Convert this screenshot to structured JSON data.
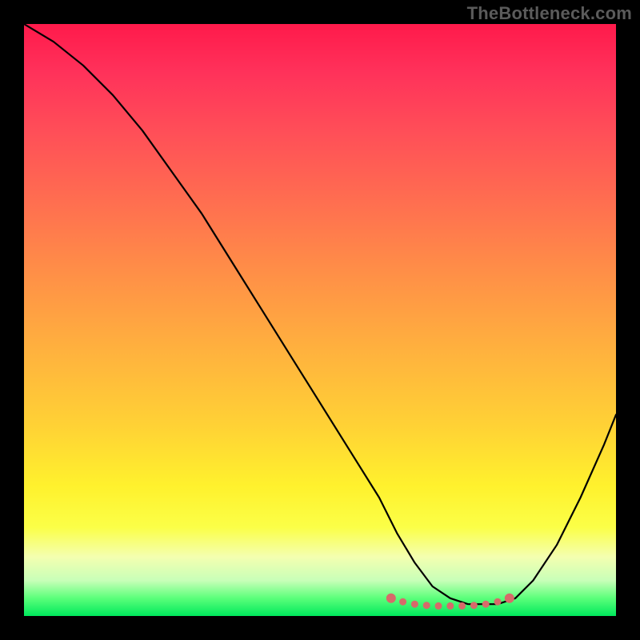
{
  "watermark": "TheBottleneck.com",
  "chart_data": {
    "type": "line",
    "title": "",
    "xlabel": "",
    "ylabel": "",
    "xlim": [
      0,
      100
    ],
    "ylim": [
      0,
      100
    ],
    "grid": false,
    "legend": false,
    "series": [
      {
        "name": "bottleneck-curve",
        "color": "#000000",
        "x": [
          0,
          5,
          10,
          15,
          20,
          25,
          30,
          35,
          40,
          45,
          50,
          55,
          60,
          63,
          66,
          69,
          72,
          75,
          78,
          80,
          83,
          86,
          90,
          94,
          98,
          100
        ],
        "y": [
          100,
          97,
          93,
          88,
          82,
          75,
          68,
          60,
          52,
          44,
          36,
          28,
          20,
          14,
          9,
          5,
          3,
          2,
          2,
          2,
          3,
          6,
          12,
          20,
          29,
          34
        ]
      }
    ],
    "markers": {
      "name": "flat-region-dots",
      "color": "#d76a6a",
      "x": [
        62,
        64,
        66,
        68,
        70,
        72,
        74,
        76,
        78,
        80,
        82
      ],
      "y": [
        3,
        2.4,
        2,
        1.8,
        1.7,
        1.7,
        1.7,
        1.8,
        2,
        2.4,
        3
      ]
    },
    "gradient_background": {
      "orientation": "vertical",
      "stops": [
        {
          "pos": 0.0,
          "color": "#ff1a4b"
        },
        {
          "pos": 0.3,
          "color": "#ff6e50"
        },
        {
          "pos": 0.55,
          "color": "#ffb13e"
        },
        {
          "pos": 0.78,
          "color": "#fff12d"
        },
        {
          "pos": 0.92,
          "color": "#f4ffb0"
        },
        {
          "pos": 1.0,
          "color": "#00e85c"
        }
      ]
    }
  }
}
